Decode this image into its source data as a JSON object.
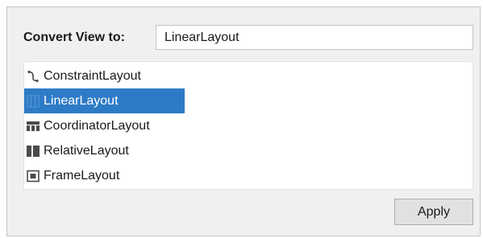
{
  "dialog": {
    "label": "Convert View to:",
    "input_value": "LinearLayout",
    "items": [
      {
        "label": "ConstraintLayout",
        "icon": "constraint-layout-icon",
        "selected": false
      },
      {
        "label": "LinearLayout",
        "icon": "linear-layout-icon",
        "selected": true
      },
      {
        "label": "CoordinatorLayout",
        "icon": "coordinator-layout-icon",
        "selected": false
      },
      {
        "label": "RelativeLayout",
        "icon": "relative-layout-icon",
        "selected": false
      },
      {
        "label": "FrameLayout",
        "icon": "frame-layout-icon",
        "selected": false
      }
    ],
    "apply_label": "Apply"
  },
  "colors": {
    "selection": "#2d7bc6",
    "panel": "#f0f0f0",
    "icon": "#4a4a4a"
  }
}
